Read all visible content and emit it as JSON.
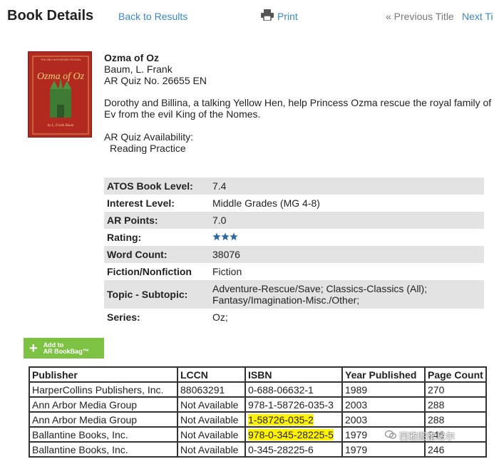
{
  "header": {
    "title": "Book Details",
    "back_link": "Back to Results",
    "print_label": "Print",
    "prev_label": "« Previous Title",
    "next_label": "Next Ti"
  },
  "book": {
    "cover_alt": "Ozma of Oz cover",
    "cover_text_top": "THE ONLY AUTHORIZED EDITION",
    "cover_title": "Ozma of Oz",
    "cover_author": "by L. Frank Baum",
    "title": "Ozma of Oz",
    "author": "Baum, L. Frank",
    "quiz": "AR Quiz No. 26655 EN",
    "description": "Dorothy and Billina, a talking Yellow Hen, help Princess Ozma rescue the royal family of Ev from the evil King of the Nomes.",
    "availability_label": "AR Quiz Availability:",
    "availability_item": "Reading Practice"
  },
  "details": [
    {
      "label": "ATOS Book Level:",
      "value": "7.4"
    },
    {
      "label": "Interest Level:",
      "value": "Middle Grades (MG 4-8)"
    },
    {
      "label": "AR Points:",
      "value": "7.0"
    },
    {
      "label": "Rating:",
      "value": "",
      "rating": 3.5
    },
    {
      "label": "Word Count:",
      "value": "38076"
    },
    {
      "label": "Fiction/Nonfiction",
      "value": "Fiction"
    },
    {
      "label": "Topic - Subtopic:",
      "value": "Adventure-Rescue/Save; Classics-Classics (All); Fantasy/Imagination-Misc./Other;"
    },
    {
      "label": "Series:",
      "value": "Oz;"
    }
  ],
  "add_button": {
    "line1": "Add to",
    "line2": "AR BookBag™"
  },
  "publishers": {
    "headers": [
      "Publisher",
      "LCCN",
      "ISBN",
      "Year Published",
      "Page Count"
    ],
    "rows": [
      [
        "HarperCollins Publishers, Inc.",
        "88063291",
        "0-688-06632-1",
        "1989",
        "270"
      ],
      [
        "Ann Arbor Media Group",
        "Not Available",
        "978-1-58726-035-3",
        "2003",
        "288"
      ],
      [
        "Ann Arbor Media Group",
        "Not Available",
        "1-58726-035-2",
        "2003",
        "288"
      ],
      [
        "Ballantine Books, Inc.",
        "Not Available",
        "978-0-345-28225-5",
        "1979",
        "246"
      ],
      [
        "Ballantine Books, Inc.",
        "Not Available",
        "0-345-28225-6",
        "1979",
        "246"
      ]
    ]
  },
  "watermark": {
    "text": "西雅图雷尼尔"
  },
  "colors": {
    "link": "#3a87c8",
    "row_shade": "#e3e3e3",
    "button": "#7dc242",
    "highlight": "#fff200",
    "star": "#2d6aa3"
  }
}
